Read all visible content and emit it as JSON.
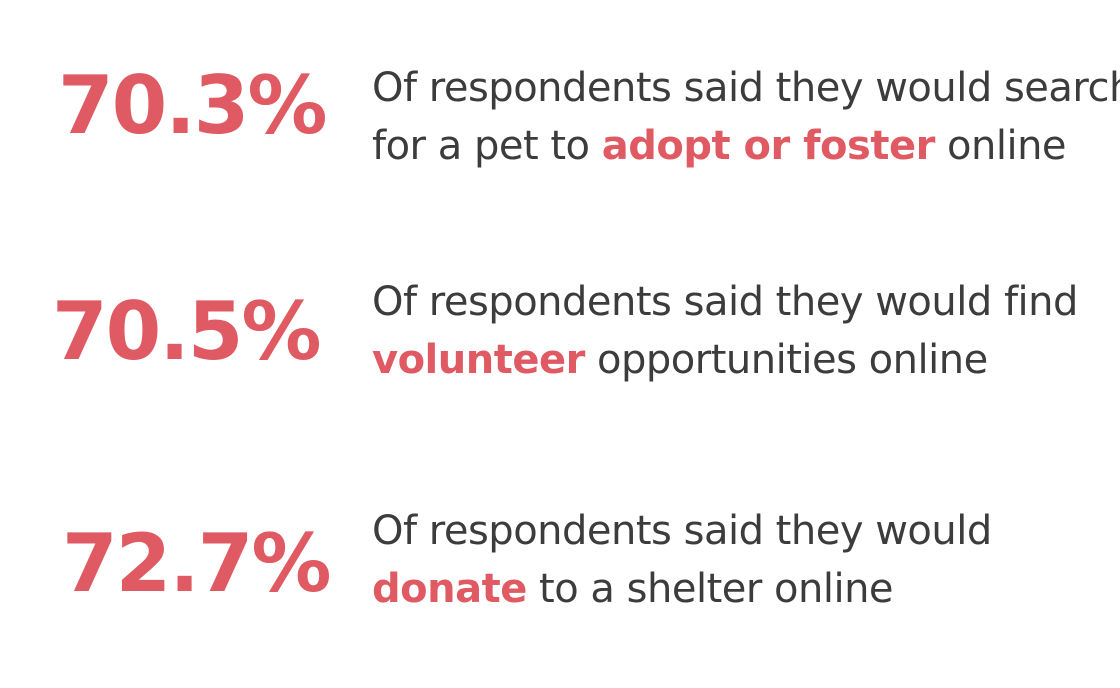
{
  "stats": [
    {
      "percent": "70.3%",
      "line1": "Of respondents said they would search",
      "line2_pre": "for a pet to ",
      "line2_highlight": "adopt or foster",
      "line2_post": " online"
    },
    {
      "percent": "70.5%",
      "line1": "Of respondents said they would find",
      "line2_pre": "",
      "line2_highlight": "volunteer",
      "line2_post": " opportunities online"
    },
    {
      "percent": "72.7%",
      "line1": "Of respondents said they would",
      "line2_pre": "",
      "line2_highlight": "donate",
      "line2_post": " to a shelter online"
    }
  ],
  "colors": {
    "accent": "#e05a63",
    "text": "#3c3c3c",
    "background": "#ffffff"
  }
}
